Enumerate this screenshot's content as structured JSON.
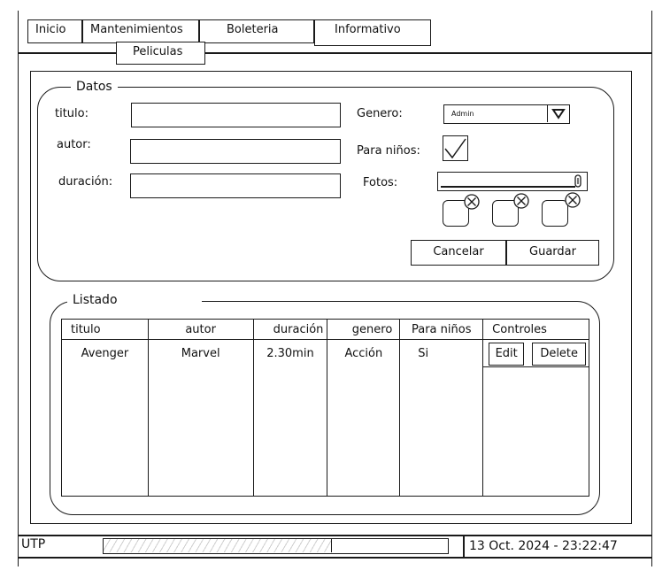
{
  "nav": {
    "tabs": [
      "Inicio",
      "Mantenimientos",
      "Boleteria",
      "Informativo"
    ],
    "sub_tab": "Peliculas"
  },
  "datos": {
    "legend": "Datos",
    "titulo_label": "titulo:",
    "autor_label": "autor:",
    "duracion_label": "duración:",
    "genero_label": "Genero:",
    "genero_value": "Admin",
    "para_ninos_label": "Para niños:",
    "para_ninos_checked": true,
    "fotos_label": "Fotos:",
    "cancel_label": "Cancelar",
    "save_label": "Guardar"
  },
  "listado": {
    "legend": "Listado",
    "columns": [
      "titulo",
      "autor",
      "duración",
      "genero",
      "Para niños",
      "Controles"
    ],
    "rows": [
      {
        "titulo": "Avenger",
        "autor": "Marvel",
        "duracion": "2.30min",
        "genero": "Acción",
        "para_ninos": "Si",
        "edit": "Edit",
        "delete": "Delete"
      }
    ]
  },
  "status": {
    "org": "UTP",
    "datetime": "13 Oct. 2024 - 23:22:47"
  }
}
